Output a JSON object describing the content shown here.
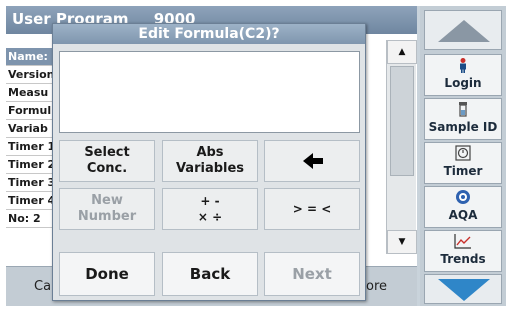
{
  "background": {
    "title_prefix": "User Program",
    "title_number": "9000",
    "rows": [
      "Name:",
      "Version",
      "Measu",
      "Formul",
      "Variab",
      "Timer 1",
      "Timer 2",
      "Timer 3",
      "Timer 4",
      "No: 2"
    ],
    "bottom_left": "Ca",
    "bottom_right": "ore"
  },
  "side_panel": {
    "tools": [
      {
        "label": "Login",
        "icon": "person-icon"
      },
      {
        "label": "Sample ID",
        "icon": "vial-icon"
      },
      {
        "label": "Timer",
        "icon": "timer-icon"
      },
      {
        "label": "AQA",
        "icon": "aqa-icon"
      },
      {
        "label": "Trends",
        "icon": "trends-chart-icon"
      }
    ]
  },
  "dialog": {
    "title": "Edit Formula(C2)?",
    "formula_value": "",
    "keys": {
      "select_conc_l1": "Select",
      "select_conc_l2": "Conc.",
      "abs_var_l1": "Abs",
      "abs_var_l2": "Variables",
      "new_number_l1": "New",
      "new_number_l2": "Number",
      "ops_l1": "+ -",
      "ops_l2": "× ÷",
      "compare": "> = <"
    },
    "done_label": "Done",
    "back_label": "Back",
    "next_label": "Next"
  }
}
